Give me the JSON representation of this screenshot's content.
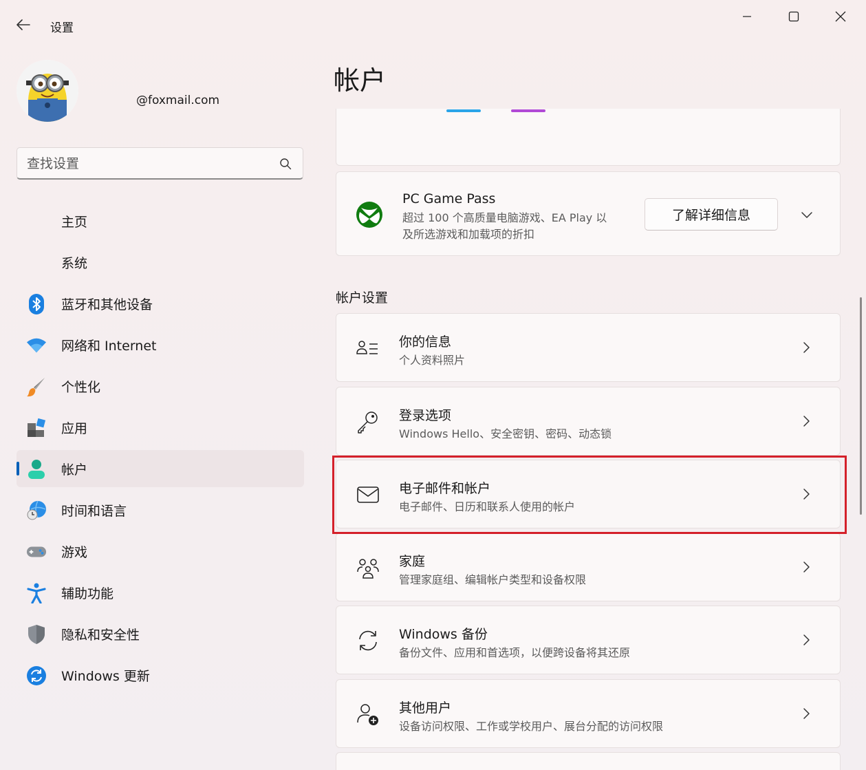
{
  "window": {
    "title": "设置"
  },
  "profile": {
    "email": "@foxmail.com"
  },
  "search": {
    "placeholder": "查找设置"
  },
  "nav": {
    "items": [
      {
        "label": "主页"
      },
      {
        "label": "系统"
      },
      {
        "label": "蓝牙和其他设备"
      },
      {
        "label": "网络和 Internet"
      },
      {
        "label": "个性化"
      },
      {
        "label": "应用"
      },
      {
        "label": "帐户"
      },
      {
        "label": "时间和语言"
      },
      {
        "label": "游戏"
      },
      {
        "label": "辅助功能"
      },
      {
        "label": "隐私和安全性"
      },
      {
        "label": "Windows 更新"
      }
    ],
    "active": "帐户"
  },
  "main": {
    "title": "帐户",
    "gamepass": {
      "title": "PC Game Pass",
      "description_line1": "超过 100 个高质量电脑游戏、EA Play 以",
      "description_line2": "及所选游戏和加载项的折扣",
      "button": "了解详细信息"
    },
    "section_title": "帐户设置",
    "rows": [
      {
        "title": "你的信息",
        "subtitle": "个人资料照片"
      },
      {
        "title": "登录选项",
        "subtitle": "Windows Hello、安全密钥、密码、动态锁"
      },
      {
        "title": "电子邮件和帐户",
        "subtitle": "电子邮件、日历和联系人使用的帐户"
      },
      {
        "title": "家庭",
        "subtitle": "管理家庭组、编辑帐户类型和设备权限"
      },
      {
        "title": "Windows 备份",
        "subtitle": "备份文件、应用和首选项，以便跨设备将其还原"
      },
      {
        "title": "其他用户",
        "subtitle": "设备访问权限、工作或学校用户、展台分配的访问权限"
      }
    ]
  },
  "colors": {
    "accent": "#005fb8",
    "highlight": "#d4202a"
  }
}
